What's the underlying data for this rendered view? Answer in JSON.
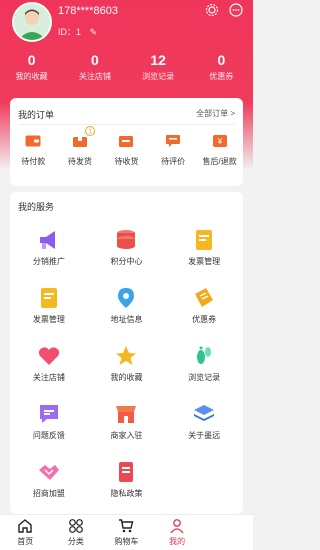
{
  "user": {
    "name": "178****8603",
    "id_text": "ID：1"
  },
  "stats": [
    {
      "value": "0",
      "label": "我的收藏"
    },
    {
      "value": "0",
      "label": "关注店铺"
    },
    {
      "value": "12",
      "label": "浏览记录"
    },
    {
      "value": "0",
      "label": "优惠券"
    }
  ],
  "orders": {
    "title": "我的订单",
    "more": "全部订单 >",
    "items": [
      {
        "label": "待付款",
        "icon": "wallet-icon"
      },
      {
        "label": "待发货",
        "icon": "package-icon",
        "badge": "1"
      },
      {
        "label": "待收货",
        "icon": "truck-icon"
      },
      {
        "label": "待评价",
        "icon": "comment-icon"
      },
      {
        "label": "售后/退款",
        "icon": "refund-icon"
      }
    ]
  },
  "services": {
    "title": "我的服务",
    "items": [
      {
        "label": "分销推广",
        "icon": "megaphone-icon"
      },
      {
        "label": "积分中心",
        "icon": "coins-icon"
      },
      {
        "label": "发票管理",
        "icon": "invoice-icon"
      },
      {
        "label": "发票管理",
        "icon": "invoice-icon"
      },
      {
        "label": "地址信息",
        "icon": "location-pin-icon"
      },
      {
        "label": "优惠券",
        "icon": "ticket-icon"
      },
      {
        "label": "关注店铺",
        "icon": "heart-icon"
      },
      {
        "label": "我的收藏",
        "icon": "star-icon"
      },
      {
        "label": "浏览记录",
        "icon": "footprint-icon"
      },
      {
        "label": "问题反馈",
        "icon": "feedback-icon"
      },
      {
        "label": "商家入驻",
        "icon": "shop-icon"
      },
      {
        "label": "关于墨远",
        "icon": "layers-icon"
      },
      {
        "label": "招商加盟",
        "icon": "handshake-icon"
      },
      {
        "label": "隐私政策",
        "icon": "document-icon"
      }
    ]
  },
  "tabbar": [
    {
      "label": "首页",
      "icon": "home-icon"
    },
    {
      "label": "分类",
      "icon": "category-icon"
    },
    {
      "label": "购物车",
      "icon": "cart-icon"
    },
    {
      "label": "我的",
      "icon": "user-icon",
      "active": true
    }
  ],
  "colors": {
    "brand": "#ef3b5c",
    "active_tab": "#e9334f"
  }
}
